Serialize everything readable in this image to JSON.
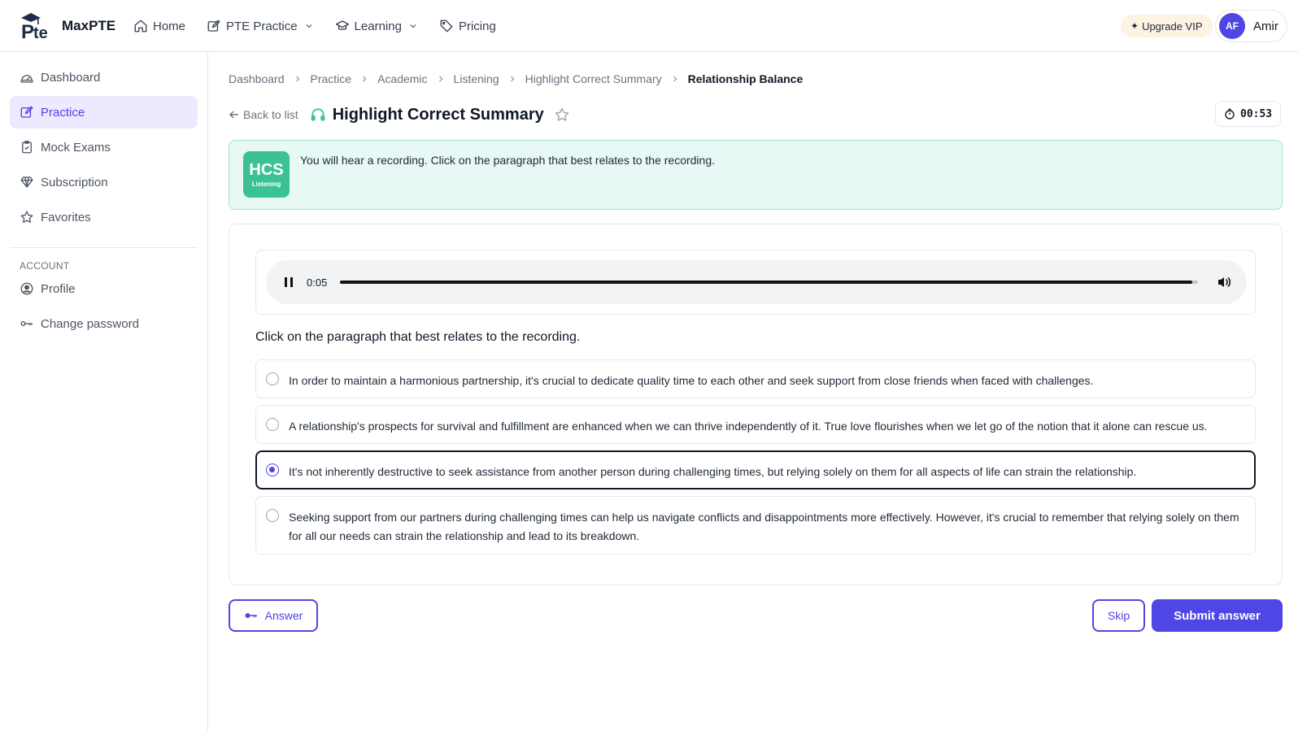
{
  "brand": {
    "name": "MaxPTE",
    "logo_text": "Pte"
  },
  "nav": {
    "home": "Home",
    "pte_practice": "PTE Practice",
    "learning": "Learning",
    "pricing": "Pricing"
  },
  "header": {
    "upgrade_label": "Upgrade VIP",
    "user_initials": "AF",
    "user_name": "Amir"
  },
  "sidebar": {
    "items": [
      {
        "label": "Dashboard",
        "icon": "dashboard-icon"
      },
      {
        "label": "Practice",
        "icon": "edit-icon",
        "active": true
      },
      {
        "label": "Mock Exams",
        "icon": "clipboard-icon"
      },
      {
        "label": "Subscription",
        "icon": "diamond-icon"
      },
      {
        "label": "Favorites",
        "icon": "star-icon"
      }
    ],
    "account_heading": "ACCOUNT",
    "account_items": [
      {
        "label": "Profile",
        "icon": "user-circle-icon"
      },
      {
        "label": "Change password",
        "icon": "key-icon"
      }
    ]
  },
  "breadcrumb": [
    "Dashboard",
    "Practice",
    "Academic",
    "Listening",
    "Highlight Correct Summary",
    "Relationship Balance"
  ],
  "page": {
    "back_label": "Back to list",
    "title": "Highlight Correct Summary",
    "timer": "00:53"
  },
  "instruction": {
    "badge_abbr": "HCS",
    "badge_sub": "Listening",
    "text": "You will hear a recording. Click on the paragraph that best relates to the recording."
  },
  "audio": {
    "current_time": "0:05",
    "progress": 0.993,
    "state": "playing"
  },
  "question": {
    "prompt": "Click on the paragraph that best relates to the recording.",
    "options": [
      "In order to maintain a harmonious partnership, it's crucial to dedicate quality time to each other and seek support from close friends when faced with challenges.",
      "A relationship's prospects for survival and fulfillment are enhanced when we can thrive independently of it. True love flourishes when we let go of the notion that it alone can rescue us.",
      "It's not inherently destructive to seek assistance from another person during challenging times, but relying solely on them for all aspects of life can strain the relationship.",
      "Seeking support from our partners during challenging times can help us navigate conflicts and disappointments more effectively. However, it's crucial to remember that relying solely on them for all our needs can strain the relationship and lead to its breakdown."
    ],
    "selected_index": 2
  },
  "actions": {
    "answer_label": "Answer",
    "skip_label": "Skip",
    "submit_label": "Submit answer"
  },
  "colors": {
    "accent": "#4f46e5",
    "active_bg": "#ede9fe",
    "instruction_bg": "#e8f8f5",
    "badge_green": "#3cc197",
    "upgrade_bg": "#fdf3e3"
  }
}
